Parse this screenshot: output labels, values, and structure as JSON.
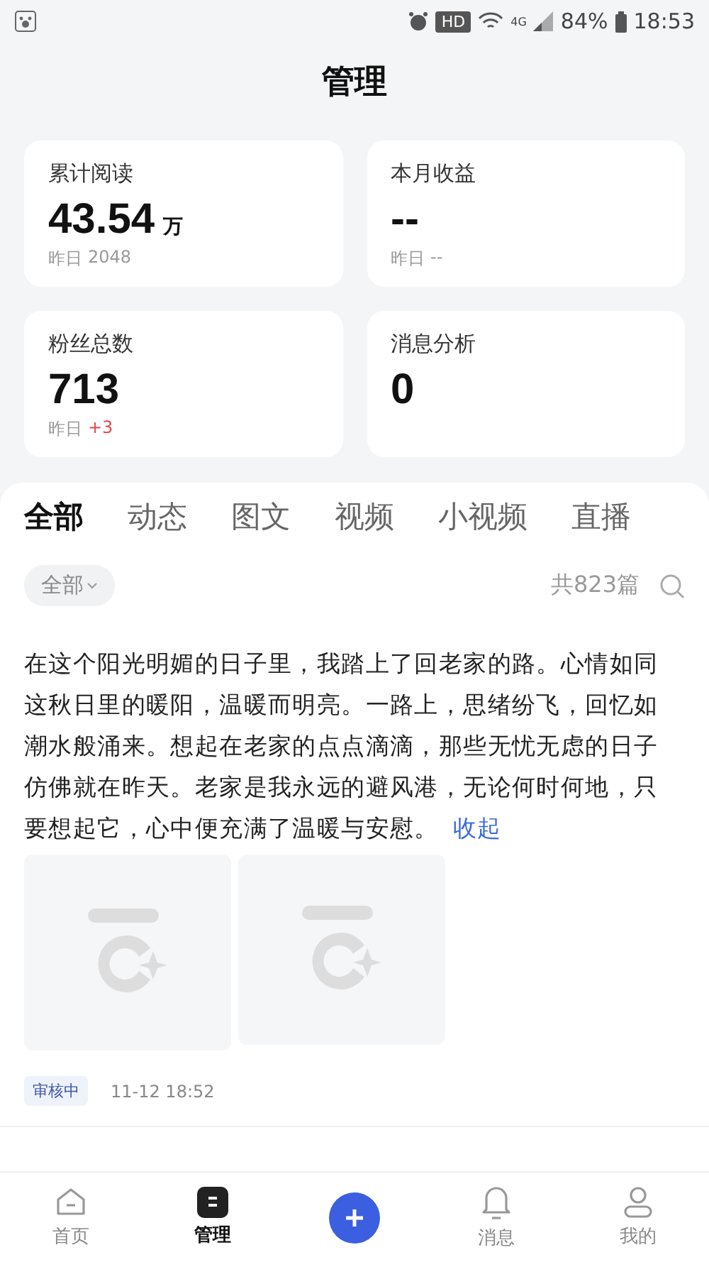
{
  "status_bar": {
    "hd": "HD",
    "network": "4G",
    "battery": "84%",
    "time": "18:53"
  },
  "title": "管理",
  "stats": [
    {
      "label": "累计阅读",
      "value": "43.54",
      "unit": "万",
      "sub_label": "昨日",
      "sub_value": "2048",
      "color": "#999999"
    },
    {
      "label": "本月收益",
      "value": "--",
      "sub_label": "昨日",
      "sub_value": "--",
      "color": "#999999"
    },
    {
      "label": "粉丝总数",
      "value": "713",
      "sub_label": "昨日",
      "sub_value": "+3",
      "color": "#e0474c"
    },
    {
      "label": "消息分析",
      "value": "0"
    }
  ],
  "tabs": [
    {
      "label": "全部",
      "selected": true
    },
    {
      "label": "动态",
      "selected": false
    },
    {
      "label": "图文",
      "selected": false
    },
    {
      "label": "视频",
      "selected": false
    },
    {
      "label": "小视频",
      "selected": false
    },
    {
      "label": "直播",
      "selected": false
    }
  ],
  "filter": {
    "label": "全部",
    "count": "共823篇"
  },
  "posts": [
    {
      "text": "在这个阳光明媚的日子里，我踏上了回老家的路。心情如同这秋日里的暖阳，温暖而明亮。一路上，思绪纷飞，回忆如潮水般涌来。想起在老家的点点滴滴，那些无忧无虑的日子仿佛就在昨天。老家是我永远的避风港，无论何时何地，只要想起它，心中便充满了温暖与安慰。",
      "toggle": "收起",
      "images": [
        {
          "kind": "placeholder"
        },
        {
          "kind": "placeholder"
        }
      ],
      "status": "审核中",
      "time": "11-12 18:52"
    }
  ],
  "nav": [
    {
      "label": "首页",
      "kind": "home",
      "selected": false
    },
    {
      "label": "管理",
      "kind": "manage",
      "selected": true
    },
    {
      "kind": "add"
    },
    {
      "label": "消息",
      "kind": "bell",
      "selected": false
    },
    {
      "label": "我的",
      "kind": "user",
      "selected": false
    }
  ]
}
